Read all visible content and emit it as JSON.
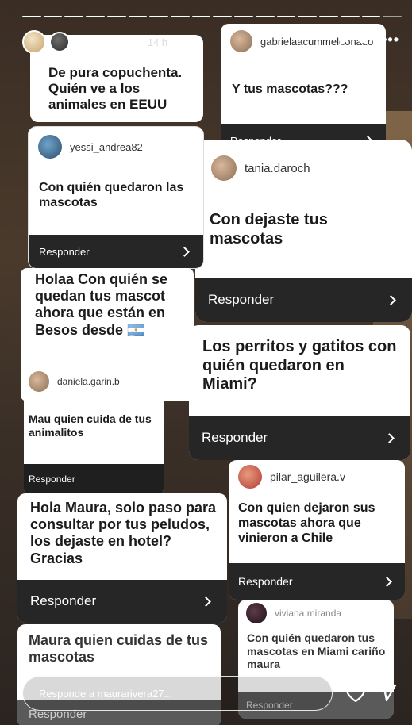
{
  "header": {
    "username": "maurarivera27",
    "collab": "otro",
    "time": "14 h"
  },
  "cards": [
    {
      "id": "c1",
      "username": "",
      "question": "De pura copuchenta.\nQuién ve a los animales en EEUU",
      "reply": ""
    },
    {
      "id": "c2",
      "username": "gabrielaacummeldonado",
      "question": "Y tus mascotas???",
      "reply": "Responder"
    },
    {
      "id": "c3",
      "username": "yessi_andrea82",
      "question": "Con quién quedaron las mascotas",
      "reply": "Responder"
    },
    {
      "id": "c4",
      "username": "tania.daroch",
      "question": "Con dejaste tus mascotas",
      "reply": "Responder"
    },
    {
      "id": "c5",
      "username": "",
      "question": "Holaa Con quién se quedan tus mascot ahora que están en Besos desde 🇦🇷",
      "reply": ""
    },
    {
      "id": "c6",
      "username": "",
      "question": "Los perritos y gatitos con quién quedaron en Miami?",
      "reply": "Responder"
    },
    {
      "id": "c7",
      "username": "daniela.garin.b",
      "question": "Mau quien cuida de tus  animalitos",
      "reply": "Responder"
    },
    {
      "id": "c8",
      "username": "",
      "question": "Hola Maura, solo paso para consultar por tus peludos, los dejaste en hotel? Gracias",
      "reply": "Responder"
    },
    {
      "id": "c9",
      "username": "pilar_aguilera.v",
      "question": "Con quien dejaron sus mascotas ahora que vinieron a Chile",
      "reply": "Responder"
    },
    {
      "id": "c10",
      "username": "",
      "question": "Maura quien cuidas de tus  mascotas",
      "reply": "Responder"
    },
    {
      "id": "c11",
      "username": "viviana.miranda",
      "question": "Con quién quedaron tus mascotas en Miami cariño maura",
      "reply": "Responder"
    }
  ],
  "message_bar": {
    "placeholder": "Responde a maurarivera27..."
  },
  "icons": {
    "like": "heart-icon",
    "share": "send-icon",
    "more": "more-icon",
    "play": "play-icon",
    "mute": "mute-icon"
  }
}
